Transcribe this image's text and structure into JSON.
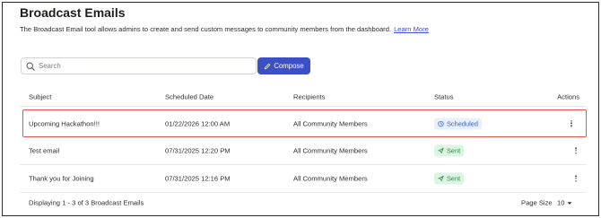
{
  "page": {
    "title": "Broadcast Emails",
    "description": "The Broadcast Email tool allows admins to create and send custom messages to community members from the dashboard.",
    "learn_more": "Learn More"
  },
  "toolbar": {
    "search_placeholder": "Search",
    "compose_label": "Compose"
  },
  "table": {
    "headers": {
      "subject": "Subject",
      "scheduled_date": "Scheduled Date",
      "recipients": "Recipients",
      "status": "Status",
      "actions": "Actions"
    },
    "rows": [
      {
        "subject": "Upcoming Hackathon!!!",
        "scheduled_date": "01/22/2026 12:00 AM",
        "recipients": "All Community Members",
        "status": "Scheduled",
        "status_icon": "clock-icon",
        "highlighted": true
      },
      {
        "subject": "Test email",
        "scheduled_date": "07/31/2025 12:20 PM",
        "recipients": "All Community Members",
        "status": "Sent",
        "status_icon": "send-icon",
        "highlighted": false
      },
      {
        "subject": "Thank you for Joining",
        "scheduled_date": "07/31/2025 12:16 PM",
        "recipients": "All Community Members",
        "status": "Sent",
        "status_icon": "send-icon",
        "highlighted": false
      }
    ]
  },
  "footer": {
    "count_text": "Displaying 1 - 3 of 3 Broadcast Emails",
    "page_size_label": "Page Size",
    "page_size_value": "10"
  },
  "colors": {
    "primary": "#3d4fc4",
    "scheduled_bg": "#e9f0fd",
    "scheduled_fg": "#2f5fd0",
    "sent_bg": "#dcf5e3",
    "sent_fg": "#2c8a4a",
    "highlight_border": "#e0574f"
  }
}
